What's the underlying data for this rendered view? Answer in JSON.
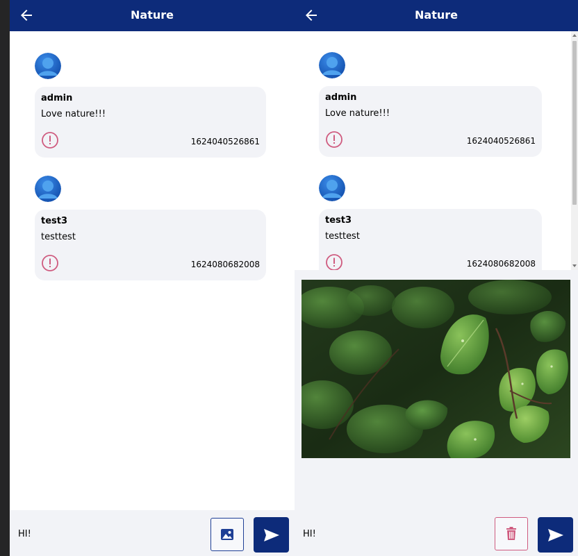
{
  "left_panel": {
    "appbar": {
      "title": "Nature"
    },
    "messages": [
      {
        "user": "admin",
        "text": "Love nature!!!",
        "time": "1624040526861"
      },
      {
        "user": "test3",
        "text": "testtest",
        "time": "1624080682008"
      }
    ],
    "input": {
      "value": "HI!"
    }
  },
  "right_panel": {
    "appbar": {
      "title": "Nature"
    },
    "messages": [
      {
        "user": "admin",
        "text": "Love nature!!!",
        "time": "1624040526861"
      },
      {
        "user": "test3",
        "text": "testtest",
        "time": "1624080682008"
      }
    ],
    "input": {
      "value": "HI!"
    }
  },
  "colors": {
    "primary": "#0d2b7a",
    "report_icon": "#cf5b7f",
    "bubble": "#f2f3f7",
    "delete_border": "#cf5b7f"
  },
  "icons": {
    "back": "arrow-left-icon",
    "avatar": "user-avatar-icon",
    "report": "alert-circle-icon",
    "image": "image-icon",
    "send": "send-icon",
    "delete": "trash-icon"
  }
}
